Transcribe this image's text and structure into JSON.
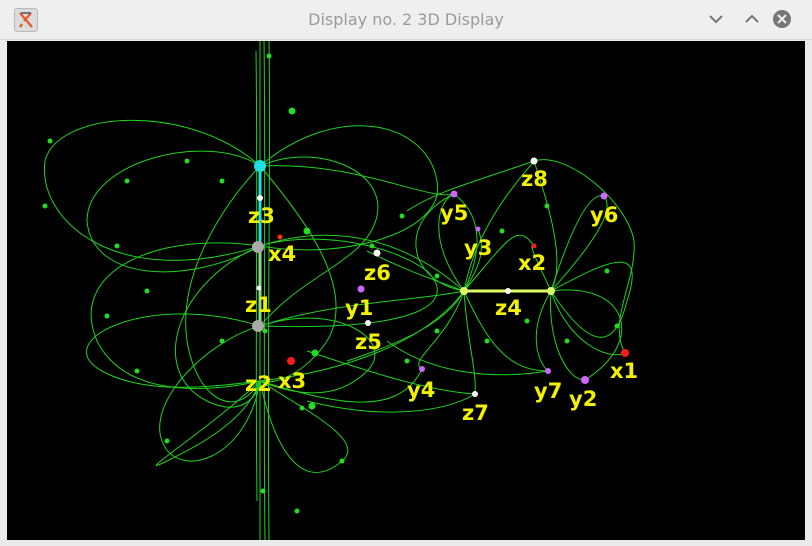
{
  "window": {
    "title": "Display no. 2 3D Display"
  },
  "icons": {
    "app": "app-x-icon",
    "minimize": "chevron-down-icon",
    "maximize": "chevron-up-icon",
    "close": "close-icon"
  },
  "colors": {
    "edges": "#22dd22",
    "labels": "#f2f200",
    "background": "#000000",
    "node_red": "#ff1a1a",
    "node_violet": "#cc66ff",
    "node_white": "#ffffff",
    "node_cyan": "#22e0e0"
  },
  "nodes": {
    "z3": "z3",
    "x4": "x4",
    "z1": "z1",
    "z2": "z2",
    "x3": "x3",
    "z6": "z6",
    "y1": "y1",
    "z5": "z5",
    "y4": "y4",
    "z7": "z7",
    "y5": "y5",
    "y3": "y3",
    "z8": "z8",
    "y6": "y6",
    "x2": "x2",
    "z4": "z4",
    "y7": "y7",
    "y2": "y2",
    "x1": "x1"
  }
}
